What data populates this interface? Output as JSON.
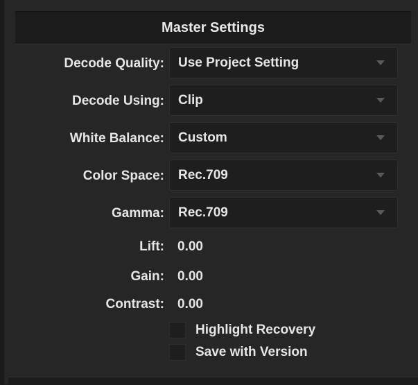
{
  "header": {
    "title": "Master Settings"
  },
  "dropdowns": [
    {
      "label": "Decode Quality:",
      "value": "Use Project Setting"
    },
    {
      "label": "Decode Using:",
      "value": "Clip"
    },
    {
      "label": "White Balance:",
      "value": "Custom"
    },
    {
      "label": "Color Space:",
      "value": "Rec.709"
    },
    {
      "label": "Gamma:",
      "value": "Rec.709"
    }
  ],
  "values": [
    {
      "label": "Lift:",
      "value": "0.00"
    },
    {
      "label": "Gain:",
      "value": "0.00"
    },
    {
      "label": "Contrast:",
      "value": "0.00"
    }
  ],
  "checkboxes": [
    {
      "label": "Highlight Recovery",
      "checked": false
    },
    {
      "label": "Save with Version",
      "checked": false
    }
  ]
}
